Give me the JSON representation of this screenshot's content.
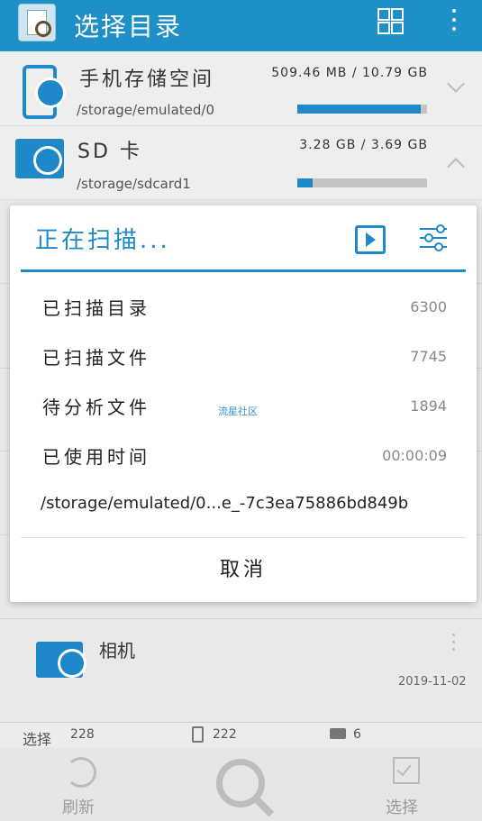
{
  "app": {
    "title": "选择目录"
  },
  "storage": [
    {
      "name": "手机存储空间",
      "path": "/storage/emulated/0",
      "size": "509.46 MB / 10.79 GB",
      "fraction": 0.95
    },
    {
      "name": "SD 卡",
      "path": "/storage/sdcard1",
      "size": "3.28 GB / 3.69 GB",
      "fraction": 0.12
    }
  ],
  "dialog": {
    "title": "正在扫描...",
    "stats": [
      {
        "label": "已扫描目录",
        "value": "6300"
      },
      {
        "label": "已扫描文件",
        "value": "7745"
      },
      {
        "label": "待分析文件",
        "value": "1894"
      },
      {
        "label": "已使用时间",
        "value": "00:00:09"
      }
    ],
    "current_path": "/storage/emulated/0...e_-7c3ea75886bd849b",
    "cancel": "取消",
    "watermark": "流星社区"
  },
  "folder": {
    "name": "相机",
    "date": "2019-11-02"
  },
  "counts": {
    "select_label": "选择",
    "selected": "228",
    "phone": "222",
    "sd": "6"
  },
  "bottom_nav": {
    "refresh": "刷新",
    "select": "选择"
  }
}
